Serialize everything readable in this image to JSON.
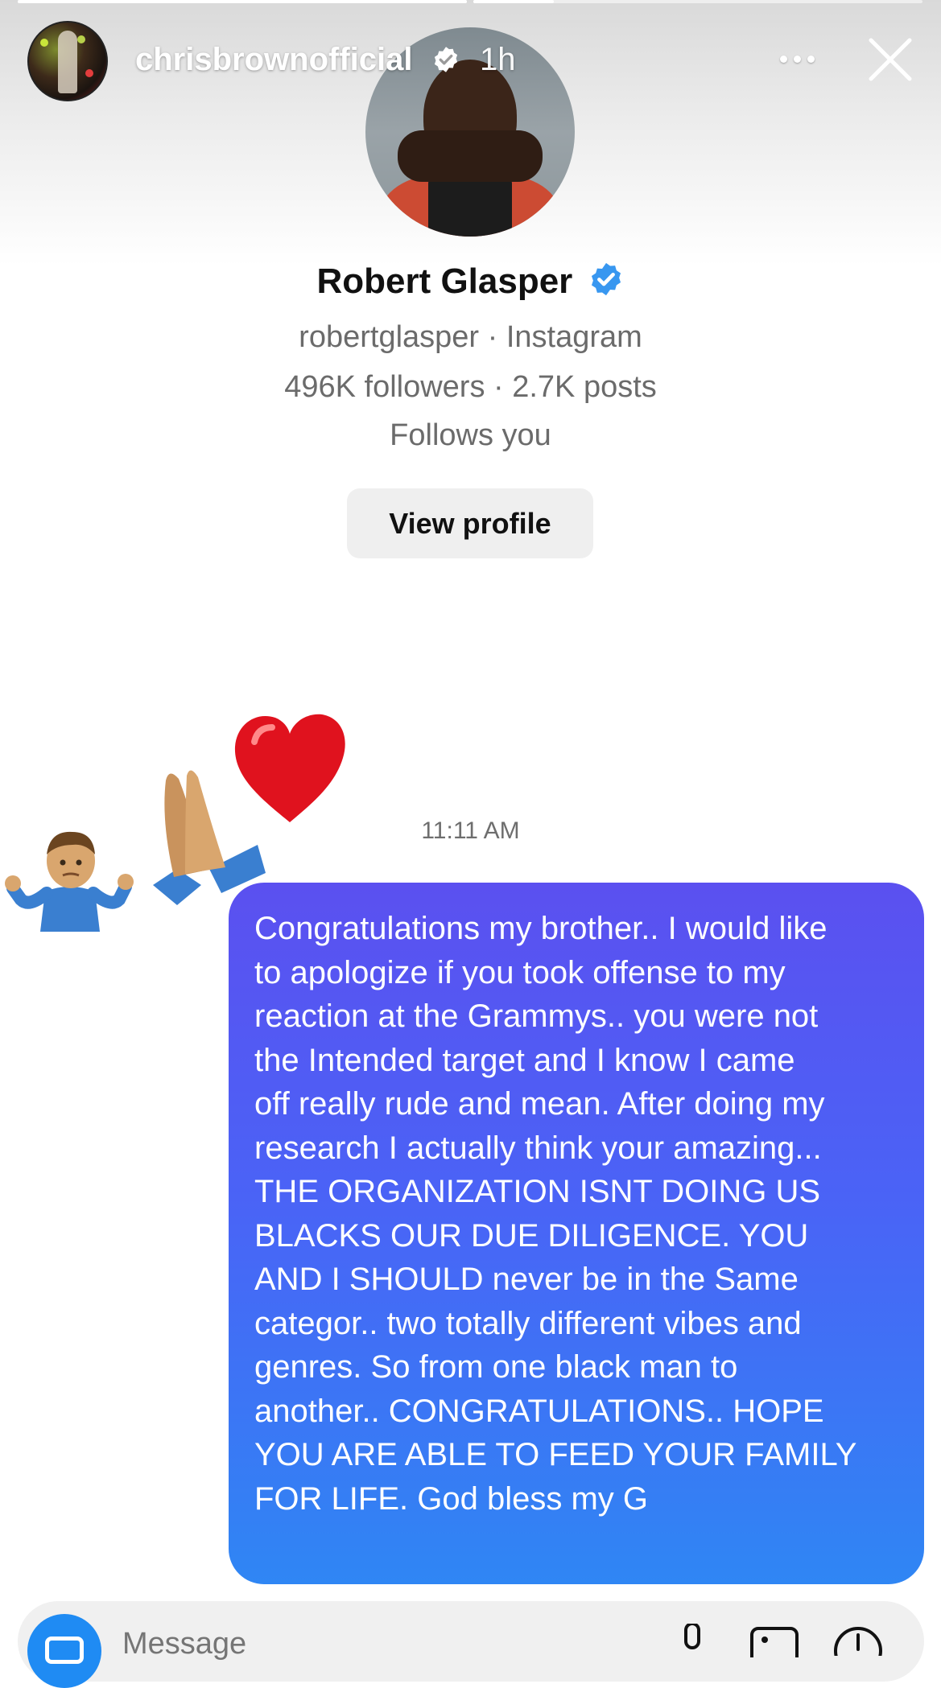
{
  "story": {
    "username": "chrisbrownofficial",
    "posted_ago": "1h",
    "progress_segments": [
      1.0,
      0.18
    ]
  },
  "profile": {
    "name": "Robert Glasper",
    "handle_line": "robertglasper · Instagram",
    "stats_line": "496K followers · 2.7K posts",
    "follows_line": "Follows you",
    "view_profile_label": "View profile"
  },
  "reactions": [
    "person-shrugging-emoji",
    "folded-hands-emoji",
    "red-heart-emoji"
  ],
  "thread": {
    "timestamp": "11:11 AM",
    "message": "Congratulations my brother.. I would like\nto apologize if you took offense to my\nreaction at the Grammys.. you were not\nthe Intended target and I know I came\noff really rude and mean. After doing my\nresearch I actually think your amazing...\nTHE ORGANIZATION ISNT DOING US\nBLACKS OUR DUE DILIGENCE. YOU\nAND I SHOULD never be in the Same\ncategor.. two totally different vibes and\ngenres. So from one black man to\nanother.. CONGRATULATIONS.. HOPE\nYOU ARE ABLE TO FEED YOUR FAMILY\nFOR LIFE. God bless my G"
  },
  "composer": {
    "placeholder": "Message"
  },
  "colors": {
    "verified": "#3897f0",
    "bubble_top": "#5b50f0",
    "bubble_bottom": "#2f86f4",
    "camera": "#1f8bf3"
  }
}
